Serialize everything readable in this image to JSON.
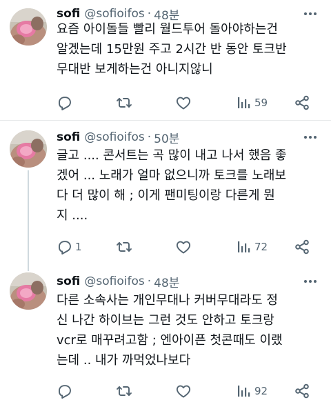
{
  "tweets": [
    {
      "display_name": "sofi",
      "handle": "@sofioifos",
      "separator": "·",
      "time": "48분",
      "lines": [
        "요즘 아이돌들 빨리 월드투어 돌아야하는건",
        "알겠는데 15만원 주고 2시간 반 동안 토크반",
        "무대반 보게하는건 아니지않니"
      ],
      "reply_count": "",
      "retweet_count": "",
      "like_count": "",
      "view_count": "59"
    },
    {
      "display_name": "sofi",
      "handle": "@sofioifos",
      "separator": "·",
      "time": "50분",
      "lines": [
        "글고 .... 콘서트는 곡 많이 내고 나서 했음 좋",
        "겠어 ... 노래가 얼마 없으니까 토크를 노래보",
        "다 더 많이 해 ; 이게 팬미팅이랑 다른게 뭔",
        "지 ...."
      ],
      "reply_count": "1",
      "retweet_count": "",
      "like_count": "",
      "view_count": "72"
    },
    {
      "display_name": "sofi",
      "handle": "@sofioifos",
      "separator": "·",
      "time": "48분",
      "lines": [
        "다른 소속사는 개인무대나 커버무대라도 정",
        "신 나간 하이브는 그런 것도 안하고 토크랑",
        "vcr로 매꾸려고함 ; 엔아이픈 첫콘때도 이랬",
        "는데 .. 내가 까먹었나보다"
      ],
      "reply_count": "",
      "retweet_count": "",
      "like_count": "",
      "view_count": "92"
    }
  ],
  "icons": {
    "more": "more-dots-icon",
    "reply": "reply-icon",
    "retweet": "retweet-icon",
    "like": "heart-icon",
    "views": "views-bar-icon",
    "share": "share-icon"
  },
  "colors": {
    "text": "#0f1419",
    "secondary": "#536471",
    "divider": "#e7e9ea",
    "thread_line": "#cfd9de"
  }
}
